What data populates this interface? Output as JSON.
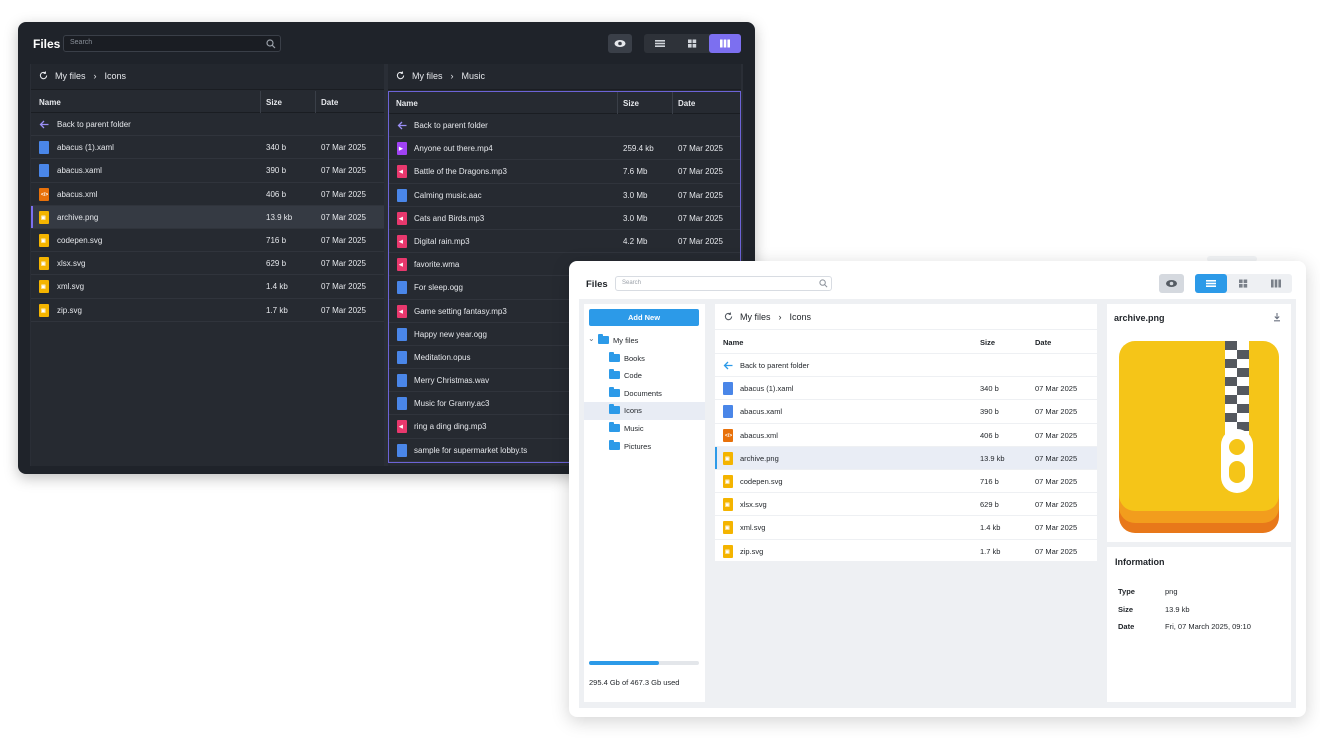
{
  "dark": {
    "title": "Files",
    "search_placeholder": "Search",
    "left_pane": {
      "breadcrumb": [
        "My files",
        "Icons"
      ],
      "columns": [
        "Name",
        "Size",
        "Date"
      ],
      "back": "Back to parent folder",
      "rows": [
        {
          "name": "abacus (1).xaml",
          "size": "340 b",
          "date": "07 Mar 2025",
          "icon": "blue"
        },
        {
          "name": "abacus.xaml",
          "size": "390 b",
          "date": "07 Mar 2025",
          "icon": "blue"
        },
        {
          "name": "abacus.xml",
          "size": "406 b",
          "date": "07 Mar 2025",
          "icon": "orange"
        },
        {
          "name": "archive.png",
          "size": "13.9 kb",
          "date": "07 Mar 2025",
          "icon": "yellow",
          "selected": true
        },
        {
          "name": "codepen.svg",
          "size": "716 b",
          "date": "07 Mar 2025",
          "icon": "yellow"
        },
        {
          "name": "xlsx.svg",
          "size": "629 b",
          "date": "07 Mar 2025",
          "icon": "yellow"
        },
        {
          "name": "xml.svg",
          "size": "1.4 kb",
          "date": "07 Mar 2025",
          "icon": "yellow"
        },
        {
          "name": "zip.svg",
          "size": "1.7 kb",
          "date": "07 Mar 2025",
          "icon": "yellow"
        }
      ]
    },
    "right_pane": {
      "breadcrumb": [
        "My files",
        "Music"
      ],
      "columns": [
        "Name",
        "Size",
        "Date"
      ],
      "back": "Back to parent folder",
      "rows": [
        {
          "name": "Anyone out there.mp4",
          "size": "259.4 kb",
          "date": "07 Mar 2025",
          "icon": "purple"
        },
        {
          "name": "Battle of the Dragons.mp3",
          "size": "7.6 Mb",
          "date": "07 Mar 2025",
          "icon": "pink"
        },
        {
          "name": "Calming music.aac",
          "size": "3.0 Mb",
          "date": "07 Mar 2025",
          "icon": "blue"
        },
        {
          "name": "Cats and Birds.mp3",
          "size": "3.0 Mb",
          "date": "07 Mar 2025",
          "icon": "pink"
        },
        {
          "name": "Digital rain.mp3",
          "size": "4.2 Mb",
          "date": "07 Mar 2025",
          "icon": "pink"
        },
        {
          "name": "favorite.wma",
          "size": "",
          "date": "",
          "icon": "pink"
        },
        {
          "name": "For sleep.ogg",
          "size": "",
          "date": "",
          "icon": "blue"
        },
        {
          "name": "Game setting fantasy.mp3",
          "size": "",
          "date": "",
          "icon": "pink"
        },
        {
          "name": "Happy new year.ogg",
          "size": "",
          "date": "",
          "icon": "blue"
        },
        {
          "name": "Meditation.opus",
          "size": "",
          "date": "",
          "icon": "blue"
        },
        {
          "name": "Merry Christmas.wav",
          "size": "",
          "date": "",
          "icon": "blue"
        },
        {
          "name": "Music for Granny.ac3",
          "size": "",
          "date": "",
          "icon": "blue"
        },
        {
          "name": "ring a ding ding.mp3",
          "size": "",
          "date": "",
          "icon": "pink"
        },
        {
          "name": "sample for supermarket lobby.ts",
          "size": "",
          "date": "",
          "icon": "blue"
        }
      ]
    }
  },
  "light": {
    "title": "Files",
    "search_placeholder": "Search",
    "add_new": "Add New",
    "tree": [
      {
        "label": "My files",
        "level": 0
      },
      {
        "label": "Books",
        "level": 1
      },
      {
        "label": "Code",
        "level": 1
      },
      {
        "label": "Documents",
        "level": 1
      },
      {
        "label": "Icons",
        "level": 1,
        "selected": true
      },
      {
        "label": "Music",
        "level": 1
      },
      {
        "label": "Pictures",
        "level": 1
      }
    ],
    "usage_text": "295.4 Gb of 467.3 Gb used",
    "usage_fraction": 0.632,
    "breadcrumb": [
      "My files",
      "Icons"
    ],
    "columns": [
      "Name",
      "Size",
      "Date"
    ],
    "back": "Back to parent folder",
    "rows": [
      {
        "name": "abacus (1).xaml",
        "size": "340 b",
        "date": "07 Mar 2025",
        "icon": "blue"
      },
      {
        "name": "abacus.xaml",
        "size": "390 b",
        "date": "07 Mar 2025",
        "icon": "blue"
      },
      {
        "name": "abacus.xml",
        "size": "406 b",
        "date": "07 Mar 2025",
        "icon": "orange"
      },
      {
        "name": "archive.png",
        "size": "13.9 kb",
        "date": "07 Mar 2025",
        "icon": "yellow",
        "selected": true
      },
      {
        "name": "codepen.svg",
        "size": "716 b",
        "date": "07 Mar 2025",
        "icon": "yellow"
      },
      {
        "name": "xlsx.svg",
        "size": "629 b",
        "date": "07 Mar 2025",
        "icon": "yellow"
      },
      {
        "name": "xml.svg",
        "size": "1.4 kb",
        "date": "07 Mar 2025",
        "icon": "yellow"
      },
      {
        "name": "zip.svg",
        "size": "1.7 kb",
        "date": "07 Mar 2025",
        "icon": "yellow"
      }
    ],
    "preview_title": "archive.png",
    "info_title": "Information",
    "info": [
      {
        "key": "Type",
        "value": "png"
      },
      {
        "key": "Size",
        "value": "13.9 kb"
      },
      {
        "key": "Date",
        "value": "Fri, 07 March 2025, 09:10"
      }
    ]
  },
  "colors": {
    "dark_accent": "#7c6ff0",
    "light_accent": "#2c9ae8"
  },
  "icons": [
    "search-icon",
    "eye-icon",
    "list-view-icon",
    "grid-view-icon",
    "column-view-icon",
    "refresh-icon",
    "arrow-left-icon",
    "folder-icon",
    "download-icon",
    "file-icon",
    "archive-zip-icon"
  ]
}
